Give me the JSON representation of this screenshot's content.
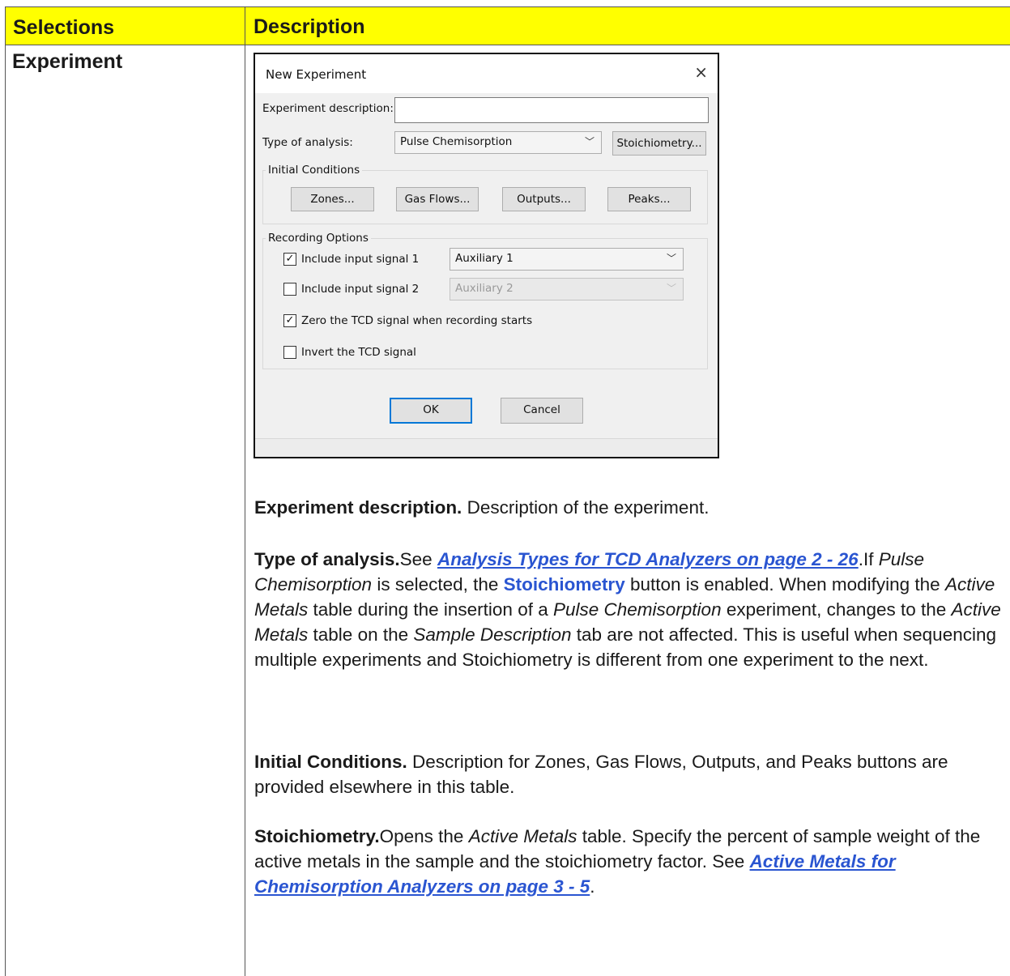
{
  "table": {
    "header": {
      "selections": "Selections",
      "description": "Description"
    },
    "row_label": "Experiment"
  },
  "dialog": {
    "title": "New Experiment",
    "close_glyph": "×",
    "experiment_description_label": "Experiment description:",
    "experiment_description_value": "",
    "type_of_analysis_label": "Type of analysis:",
    "type_of_analysis_value": "Pulse Chemisorption",
    "stoichiometry_button": "Stoichiometry...",
    "initial_conditions_label": "Initial Conditions",
    "zones_button": "Zones...",
    "gas_flows_button": "Gas Flows...",
    "outputs_button": "Outputs...",
    "peaks_button": "Peaks...",
    "recording_options_label": "Recording Options",
    "include_signal_1_label": "Include input signal 1",
    "include_signal_1_checked": true,
    "signal_1_value": "Auxiliary 1",
    "include_signal_2_label": "Include input signal 2",
    "include_signal_2_checked": false,
    "signal_2_value": "Auxiliary 2",
    "zero_tcd_label": "Zero the TCD signal when recording starts",
    "zero_tcd_checked": true,
    "invert_tcd_label": "Invert the TCD signal",
    "invert_tcd_checked": false,
    "ok_button": "OK",
    "cancel_button": "Cancel",
    "check_glyph": "✓",
    "chevron_glyph": "﹀"
  },
  "descriptions": {
    "p1": {
      "term": "Experiment description.",
      "text": " Description of the experiment."
    },
    "p2": {
      "term": "Type of analysis.",
      "see": "See ",
      "link": "Analysis Types for TCD Analyzers on page 2 - 26",
      "t1": ".If ",
      "i1": "Pulse Chemisorption",
      "t2": " is selected, the ",
      "button_ref": "Stoichiometry",
      "t3": " button is enabled. When modifying the ",
      "i2": "Active Metals",
      "t4": " table during the insertion of a ",
      "i3": "Pulse Chemisorption",
      "t5": " experiment, changes to the ",
      "i4": "Active Metals",
      "t6": " table on the ",
      "i5": "Sample Description",
      "t7": " tab are not affected. This is useful when sequencing multiple experiments and Stoichiometry is different from one experiment to the next."
    },
    "p3": {
      "term": "Initial Conditions.",
      "text": " Description for Zones, Gas Flows, Outputs, and Peaks buttons are provided elsewhere in this table."
    },
    "p4": {
      "term": "Stoichiometry.",
      "t1": "Opens the ",
      "i1": "Active Metals",
      "t2": " table. Specify the percent of sample weight of the active metals in the sample and the stoichiometry factor. See  ",
      "link": "Active Metals for Chemisorption Analyzers on page 3 - 5",
      "t3": "."
    }
  }
}
